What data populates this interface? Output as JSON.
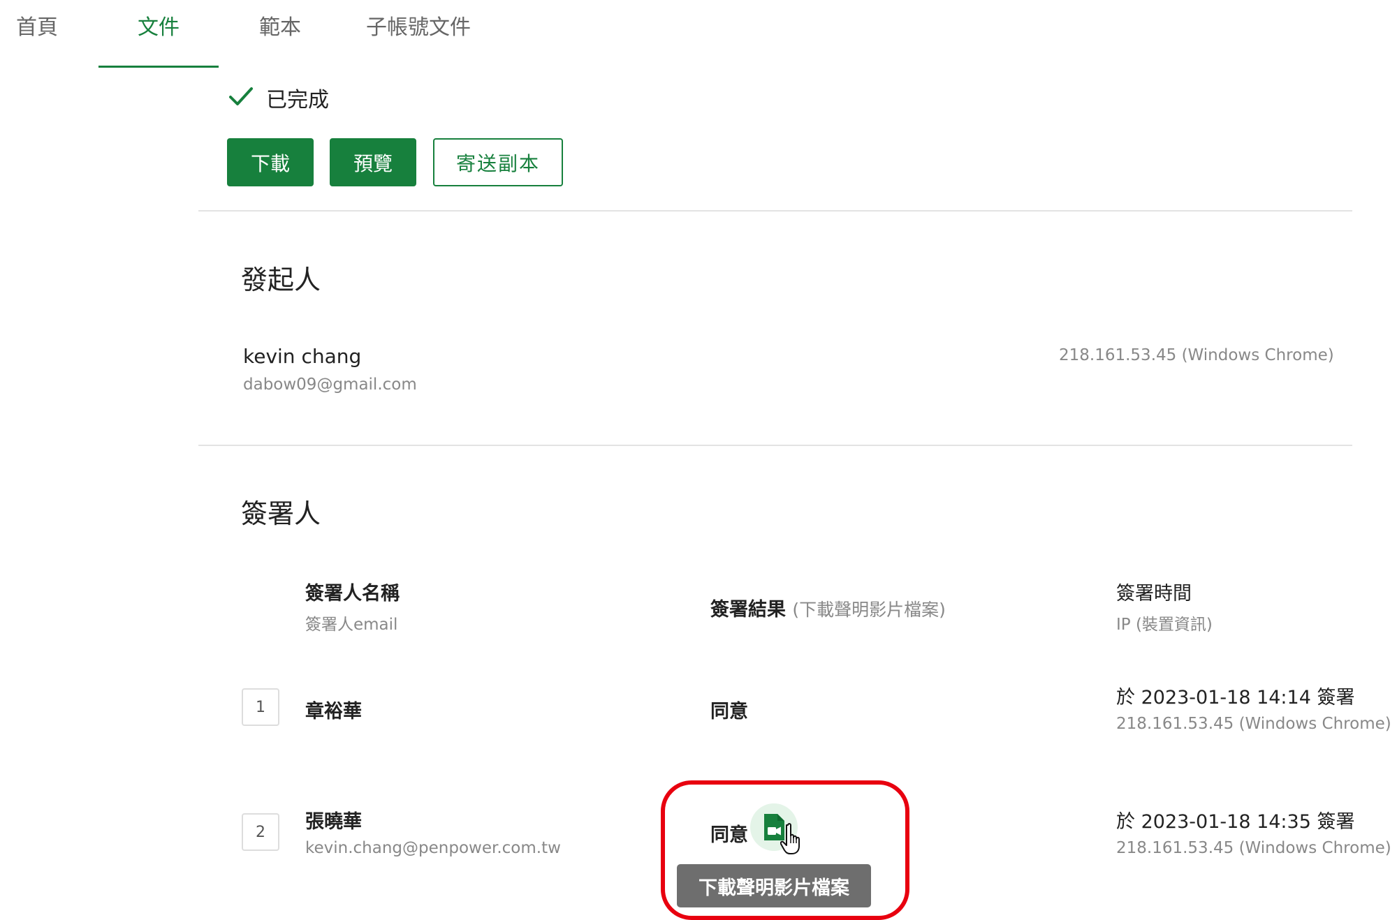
{
  "tabs": [
    {
      "label": "首頁"
    },
    {
      "label": "文件",
      "active": true
    },
    {
      "label": "範本"
    },
    {
      "label": "子帳號文件"
    }
  ],
  "status": {
    "label": "已完成",
    "icon": "check-icon"
  },
  "actions": {
    "download": "下載",
    "preview": "預覽",
    "send_copy": "寄送副本"
  },
  "initiator": {
    "title": "發起人",
    "name": "kevin chang",
    "email": "dabow09@gmail.com",
    "ip": "218.161.53.45 (Windows Chrome)"
  },
  "signers": {
    "title": "簽署人",
    "headers": {
      "name": "簽署人名稱",
      "email": "簽署人email",
      "result": "簽署結果",
      "result_note": "(下載聲明影片檔案)",
      "time": "簽署時間",
      "ip": "IP (裝置資訊)"
    },
    "rows": [
      {
        "order": "1",
        "name": "章裕華",
        "email": "",
        "result": "同意",
        "time": "於 2023-01-18 14:14 簽署",
        "ip": "218.161.53.45 (Windows Chrome)"
      },
      {
        "order": "2",
        "name": "張曉華",
        "email": "kevin.chang@penpower.com.tw",
        "result": "同意",
        "time": "於 2023-01-18 14:35 簽署",
        "ip": "218.161.53.45 (Windows Chrome)"
      }
    ]
  },
  "tooltip": "下載聲明影片檔案",
  "colors": {
    "brand": "#17803d",
    "highlight": "#e8000f",
    "tooltip_bg": "#6e6e6e"
  }
}
